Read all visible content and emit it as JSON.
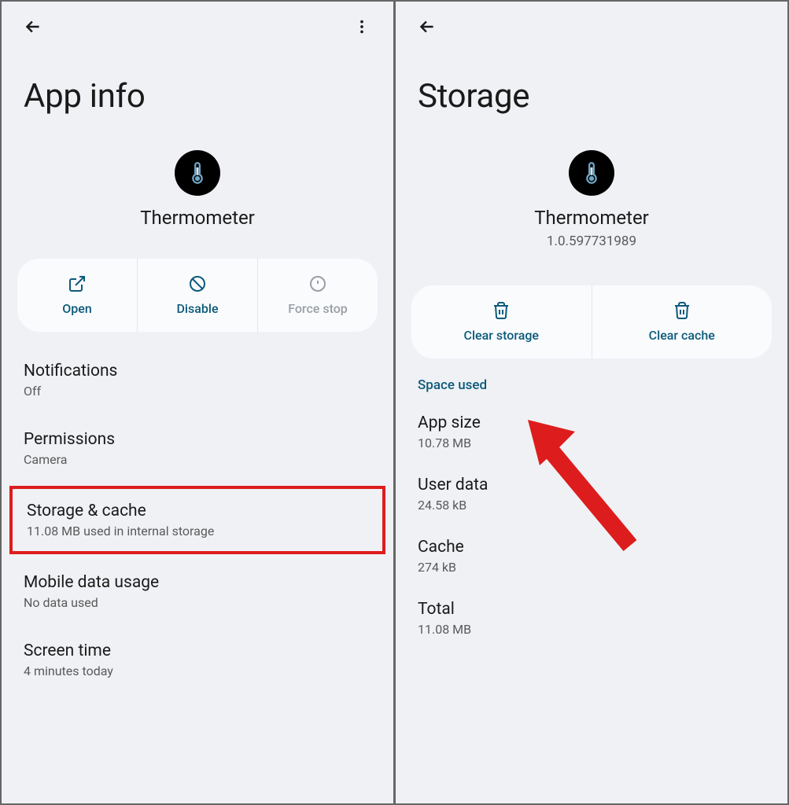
{
  "left": {
    "title": "App info",
    "app_name": "Thermometer",
    "actions": {
      "open": "Open",
      "disable": "Disable",
      "force_stop": "Force stop"
    },
    "items": [
      {
        "title": "Notifications",
        "subtitle": "Off"
      },
      {
        "title": "Permissions",
        "subtitle": "Camera"
      },
      {
        "title": "Storage & cache",
        "subtitle": "11.08 MB used in internal storage",
        "highlight": true
      },
      {
        "title": "Mobile data usage",
        "subtitle": "No data used"
      },
      {
        "title": "Screen time",
        "subtitle": "4 minutes today"
      }
    ]
  },
  "right": {
    "title": "Storage",
    "app_name": "Thermometer",
    "app_version": "1.0.597731989",
    "actions": {
      "clear_storage": "Clear storage",
      "clear_cache": "Clear cache"
    },
    "section_label": "Space used",
    "rows": [
      {
        "title": "App size",
        "value": "10.78 MB"
      },
      {
        "title": "User data",
        "value": "24.58 kB"
      },
      {
        "title": "Cache",
        "value": "274 kB"
      },
      {
        "title": "Total",
        "value": "11.08 MB"
      }
    ]
  }
}
